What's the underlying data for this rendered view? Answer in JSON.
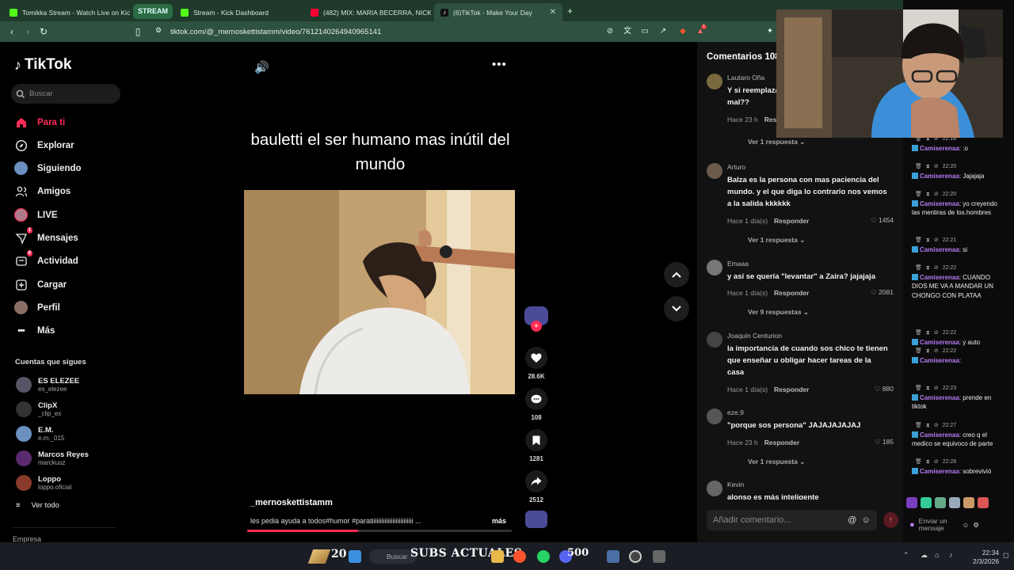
{
  "browser": {
    "tabs": [
      {
        "title": "Tomikka Stream - Watch Live on Kick",
        "color": "#53fc18"
      },
      {
        "title": "Stream - Kick Dashboard",
        "color": "#53fc18"
      },
      {
        "title": "(482) MIX: MARIA BECERRA, NICKI N",
        "color": "#ff0033"
      },
      {
        "title": "(6)TikTok - Make Your Day",
        "color": "#ffffff"
      }
    ],
    "tab_group_label": "STREAM",
    "right_tab_title": "kick.co",
    "url": "tiktok.com/@_mernoskettistamm/video/7612140264940965141",
    "extension_badge": "1"
  },
  "tiktok": {
    "brand": "TikTok",
    "search_placeholder": "Buscar",
    "nav": [
      {
        "label": "Para ti",
        "icon": "home-icon",
        "active": true
      },
      {
        "label": "Explorar",
        "icon": "compass-icon"
      },
      {
        "label": "Siguiendo",
        "icon": "following-avatar"
      },
      {
        "label": "Amigos",
        "icon": "friends-icon"
      },
      {
        "label": "LIVE",
        "icon": "live-avatar"
      },
      {
        "label": "Mensajes",
        "icon": "messages-icon",
        "badge": "1"
      },
      {
        "label": "Actividad",
        "icon": "activity-icon",
        "badge": "6"
      },
      {
        "label": "Cargar",
        "icon": "upload-icon"
      },
      {
        "label": "Perfil",
        "icon": "profile-avatar"
      },
      {
        "label": "Más",
        "icon": "more-dots-icon"
      }
    ],
    "following_title": "Cuentas que sigues",
    "following": [
      {
        "name": "ES ELEZEE",
        "handle": "es_elezee",
        "color": "#556"
      },
      {
        "name": "ClipX",
        "handle": "_clip_ex",
        "color": "#333"
      },
      {
        "name": "E.M.",
        "handle": "e.m._015",
        "color": "#6b8fbf"
      },
      {
        "name": "Marcos Reyes",
        "handle": "marckuuz",
        "color": "#5a2a6e"
      },
      {
        "name": "Loppo",
        "handle": "loppo.oficial",
        "color": "#8a3a2a"
      }
    ],
    "see_all": "Ver todo",
    "company": "Empresa"
  },
  "video": {
    "caption": "bauletti el ser humano mas inútil del mundo",
    "author": "_mernoskettistamm",
    "description": "les pedia ayuda a todos#humor #paratiiiiiiiiiiiiiiiiiiiiiiiiii ...",
    "more_label": "más",
    "progress": 0.42,
    "likes": "28.6K",
    "comments": "108",
    "saves": "1281",
    "shares": "2512"
  },
  "comments_panel": {
    "title": "Comentarios 108",
    "reply_label": "Responder",
    "add_placeholder": "Añadir comentario...",
    "items": [
      {
        "user": "Lautaro Oña",
        "text": "Y si reemplazan a Balza por Bauletti? Estaría mal??",
        "time": "Hace 23 h",
        "likes": "",
        "replies": "Ver 1 respuesta",
        "color": "#7a6a40"
      },
      {
        "user": "Arturo",
        "text": "Balza es la persona con mas paciencia del mundo. y el que diga lo contrario nos vemos a la salida kkkkkk",
        "time": "Hace 1 día(s)",
        "likes": "1454",
        "replies": "Ver 1 respuesta",
        "color": "#6b5a4a"
      },
      {
        "user": "Emaaa",
        "text": "y así se quería \"levantar\" a Zaira? jajajaja",
        "time": "Hace 1 día(s)",
        "likes": "2081",
        "replies": "Ver 9 respuestas",
        "color": "#777"
      },
      {
        "user": "Joaquin Centurion",
        "text": "la importancia de cuando sos chico te tienen que enseñar u obligar hacer tareas de la casa",
        "time": "Hace 1 día(s)",
        "likes": "880",
        "replies": "",
        "color": "#444"
      },
      {
        "user": "eze.9",
        "text": "\"porque sos persona\" JAJAJAJAJAJ",
        "time": "Hace 23 h",
        "likes": "185",
        "replies": "Ver 1 respuesta",
        "color": "#555"
      },
      {
        "user": "Kevin",
        "text": "alonso es más inteligente",
        "time": "",
        "likes": "",
        "replies": "",
        "color": "#666"
      }
    ]
  },
  "chat": {
    "user": "Camiserenaa",
    "messages": [
      {
        "time": "22:18",
        "text": ":o"
      },
      {
        "time": "22:20",
        "text": "Jajajaja"
      },
      {
        "time": "22:20",
        "text": "yo creyendo las mentiras de los.hombres"
      },
      {
        "time": "22:21",
        "text": "si"
      },
      {
        "time": "22:22",
        "text": "CUANDO DIOS ME VA A MANDAR UN CHONGO CON PLATAA"
      },
      {
        "time": "22:22",
        "text": "y auto"
      },
      {
        "time": "22:22",
        "text": ""
      },
      {
        "time": "22:23",
        "text": "prende en tiktok"
      },
      {
        "time": "22:27",
        "text": "creo q el medico se equivoco de parte"
      },
      {
        "time": "22:28",
        "text": "sobrevivió"
      }
    ],
    "input_placeholder": "Enviar un mensaje"
  },
  "taskbar": {
    "count_a": "20",
    "overlay": "SUBS ACTUALES",
    "count_b": "500",
    "search_placeholder": "Buscar",
    "time": "22:34",
    "date": "2/3/2026"
  }
}
